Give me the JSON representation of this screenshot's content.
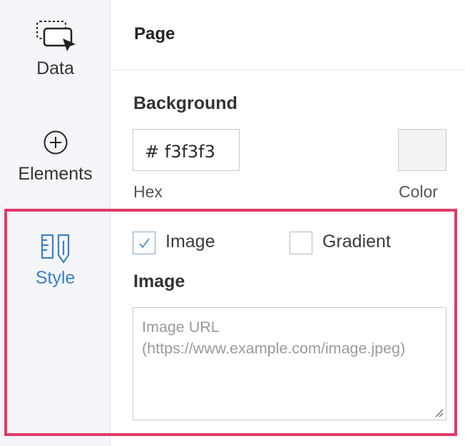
{
  "sidebar": {
    "items": [
      {
        "label": "Data",
        "icon": "data-select-icon"
      },
      {
        "label": "Elements",
        "icon": "plus-circle-icon"
      },
      {
        "label": "Style",
        "icon": "style-icon",
        "active": true
      }
    ]
  },
  "header": {
    "title": "Page"
  },
  "background": {
    "label": "Background",
    "hex_value": "# f3f3f3",
    "hex_caption": "Hex",
    "color_caption": "Color",
    "swatch_color": "#f3f3f3"
  },
  "options": {
    "image_checkbox": {
      "label": "Image",
      "checked": true
    },
    "gradient_checkbox": {
      "label": "Gradient",
      "checked": false
    }
  },
  "image": {
    "heading": "Image",
    "url_placeholder": "Image URL (https://www.example.com/image.jpeg)",
    "url_value": ""
  },
  "colors": {
    "accent": "#3d7fc6",
    "highlight": "#e03a66",
    "sidebar_bg": "#f4f5f8"
  }
}
